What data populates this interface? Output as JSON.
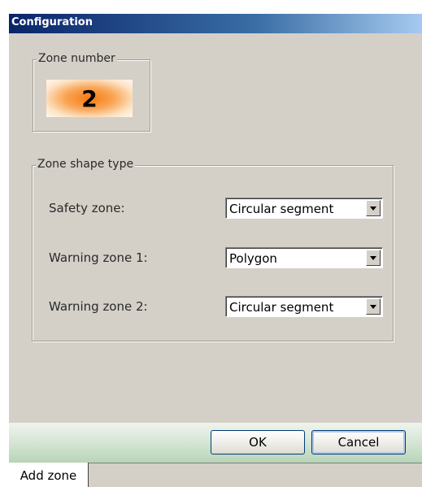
{
  "window": {
    "title": "Configuration"
  },
  "zone_number": {
    "legend": "Zone number",
    "value": "2"
  },
  "zone_shape": {
    "legend": "Zone shape type",
    "rows": [
      {
        "label": "Safety zone:",
        "value": "Circular segment"
      },
      {
        "label": "Warning zone 1:",
        "value": "Polygon"
      },
      {
        "label": "Warning zone 2:",
        "value": "Circular segment"
      }
    ]
  },
  "buttons": {
    "ok_label": "OK",
    "cancel_label": "Cancel"
  },
  "tabs": [
    {
      "label": "Add zone",
      "active": true
    }
  ],
  "colors": {
    "title_bar": "#0a246a",
    "zone_number_highlight": "#f57a10",
    "button_bar": "#cfe2cf",
    "window_background": "#d4d0c8"
  },
  "icons": {
    "combo_arrow": "chevron-down-icon"
  }
}
